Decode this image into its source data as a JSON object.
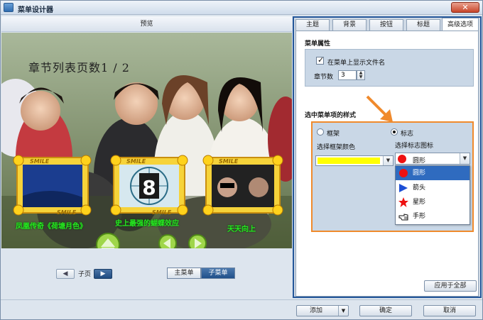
{
  "window": {
    "title": "菜单设计器",
    "close_glyph": "✕"
  },
  "preview": {
    "header": "预览",
    "menu_heading": "章节列表页数1 / 2",
    "items": [
      {
        "label": "凤凰传奇《荷塘月色》"
      },
      {
        "label": "史上最强的蝴蝶效应"
      },
      {
        "label": "天天向上"
      }
    ],
    "frame_text": "SMILE",
    "thumb_number": "8",
    "nav": {
      "prev_glyph": "◀",
      "next_glyph": "▶",
      "subpage_label": "子页",
      "main_menu_label": "主菜单",
      "sub_menu_label": "子菜单"
    }
  },
  "settings": {
    "tabs": [
      {
        "label": "主题"
      },
      {
        "label": "背景"
      },
      {
        "label": "按钮"
      },
      {
        "label": "标题"
      },
      {
        "label": "高级选项",
        "active": true
      }
    ],
    "menu_properties": {
      "title": "菜单属性",
      "show_filename_label": "在菜单上显示文件名",
      "show_filename_checked": true,
      "chapter_count_label": "章节数",
      "chapter_count_value": "3"
    },
    "selected_item_style": {
      "title": "选中菜单项的样式",
      "frame_option": "框架",
      "marker_option": "标志",
      "selected_option": "marker",
      "frame_color_label": "选择框架颜色",
      "frame_color": "#ffff00",
      "marker_icon_label": "选择标志图标",
      "marker_icon_value": "圆形",
      "icon_options": [
        {
          "label": "圆形",
          "icon": "circle-icon",
          "color": "#ee1111",
          "selected": true
        },
        {
          "label": "箭头",
          "icon": "arrow-icon",
          "color": "#1d4fd6"
        },
        {
          "label": "星形",
          "icon": "star-icon",
          "color": "#ee1111"
        },
        {
          "label": "手形",
          "icon": "hand-icon",
          "color": "#111111"
        }
      ]
    },
    "apply_all_label": "应用于全部"
  },
  "footer": {
    "add_label": "添加",
    "ok_label": "确定",
    "cancel_label": "取消"
  },
  "colors": {
    "accent_orange": "#f08a2c",
    "panel_border_blue": "#24579a",
    "item_label_green": "#27e821"
  }
}
